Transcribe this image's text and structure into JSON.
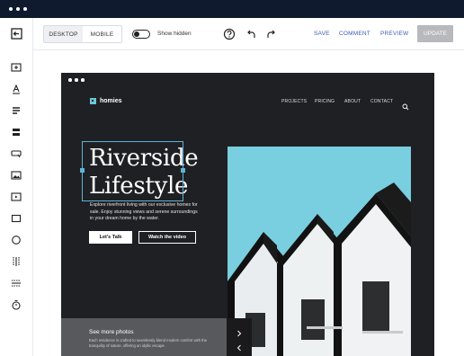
{
  "window": {
    "controls": [
      "dot",
      "dot",
      "dot"
    ]
  },
  "toolbar": {
    "desktop_label": "DESKTOP",
    "mobile_label": "MOBILE",
    "show_hidden_label": "Show hidden",
    "save_label": "SAVE",
    "comment_label": "COMMENT",
    "preview_label": "PREVIEW",
    "update_label": "UPDATE"
  },
  "sidebar": {
    "items": [
      "exit-icon",
      "section-icon",
      "text-icon",
      "paragraph-icon",
      "list-icon",
      "button-icon",
      "image-icon",
      "video-icon",
      "rectangle-icon",
      "circle-icon",
      "columns-icon",
      "divider-icon",
      "timer-icon"
    ]
  },
  "site": {
    "logo": "homies",
    "nav": [
      "PROJECTS",
      "PRICING",
      "ABOUT",
      "CONTACT"
    ],
    "hero_title": "Riverside Lifestyle",
    "hero_desc": "Explore riverfront living with our exclusive homes for sale. Enjoy stunning views and serene surroundings in your dream home by the water.",
    "cta_primary": "Let's Talk",
    "cta_secondary": "Watch the video",
    "more_title": "See more photos",
    "more_desc": "Each residence is crafted to seamlessly blend modern comfort with the tranquility of nature, offering an idyllic escape."
  },
  "colors": {
    "topbar": "#101a2e",
    "link": "#3d5bb3",
    "selection": "#5fb3d6",
    "site_bg": "#1f2023",
    "sky": "#79cfe0"
  }
}
